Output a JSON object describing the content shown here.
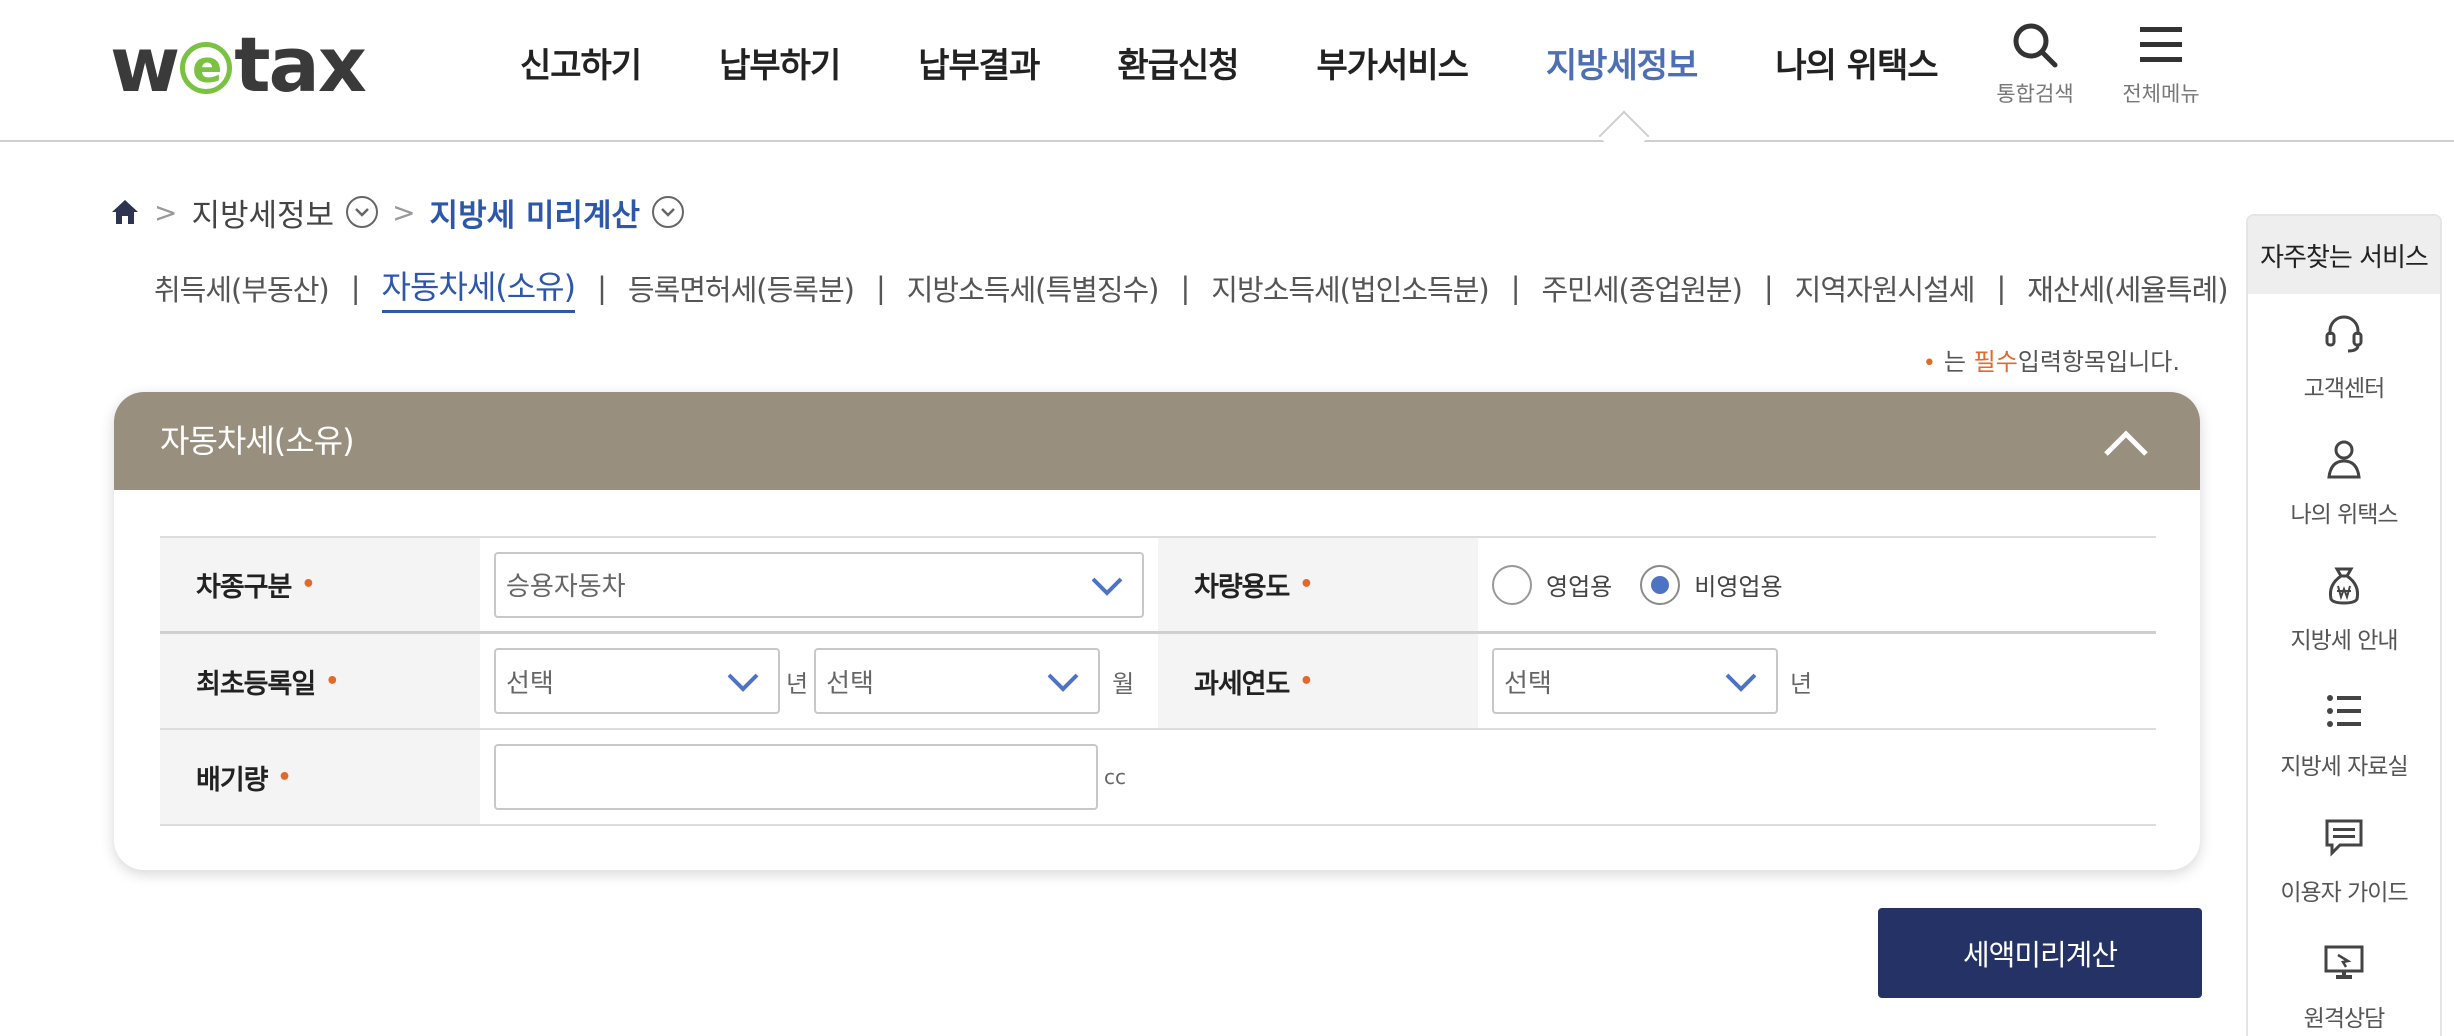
{
  "header": {
    "logo_prefix": "w",
    "logo_e": "e",
    "logo_suffix": "tax",
    "nav": [
      {
        "label": "신고하기"
      },
      {
        "label": "납부하기"
      },
      {
        "label": "납부결과"
      },
      {
        "label": "환급신청"
      },
      {
        "label": "부가서비스"
      },
      {
        "label": "지방세정보",
        "active": true
      },
      {
        "label": "나의 위택스"
      }
    ],
    "search_label": "통합검색",
    "menu_label": "전체메뉴",
    "active_color": "#4e6fb3"
  },
  "breadcrumb": {
    "home_icon": "home-icon",
    "level1": "지방세정보",
    "level2": "지방세 미리계산"
  },
  "subtabs": [
    {
      "label": "취득세(부동산)"
    },
    {
      "label": "자동차세(소유)",
      "active": true
    },
    {
      "label": "등록면허세(등록분)"
    },
    {
      "label": "지방소득세(특별징수)"
    },
    {
      "label": "지방소득세(법인소득분)"
    },
    {
      "label": "주민세(종업원분)"
    },
    {
      "label": "지역자원시설세"
    },
    {
      "label": "재산세(세율특례)"
    }
  ],
  "required_note": {
    "bullet": "•",
    "prefix": "는",
    "highlight": "필수",
    "suffix": "입력항목입니다."
  },
  "panel": {
    "title": "자동차세(소유)",
    "header_color": "#988f7f",
    "form": {
      "vehicle_type": {
        "label": "차종구분",
        "value": "승용자동차"
      },
      "vehicle_use": {
        "label": "차량용도",
        "options": [
          {
            "label": "영업용",
            "selected": false
          },
          {
            "label": "비영업용",
            "selected": true
          }
        ]
      },
      "first_registration": {
        "label": "최초등록일",
        "year_value": "선택",
        "year_unit": "년",
        "month_value": "선택",
        "month_unit": "월"
      },
      "tax_year": {
        "label": "과세연도",
        "value": "선택",
        "unit": "년"
      },
      "displacement": {
        "label": "배기량",
        "value": "",
        "unit": "cc"
      },
      "required_mark": "•"
    }
  },
  "calc_button": {
    "label": "세액미리계산",
    "color": "#243266"
  },
  "quick_menu": {
    "title": "자주찾는 서비스",
    "items": [
      {
        "label": "고객센터",
        "icon": "headset-icon"
      },
      {
        "label": "나의 위택스",
        "icon": "user-icon"
      },
      {
        "label": "지방세 안내",
        "icon": "money-bag-icon"
      },
      {
        "label": "지방세 자료실",
        "icon": "list-icon"
      },
      {
        "label": "이용자 가이드",
        "icon": "chat-icon"
      },
      {
        "label": "원격상담",
        "icon": "remote-monitor-icon"
      }
    ]
  }
}
